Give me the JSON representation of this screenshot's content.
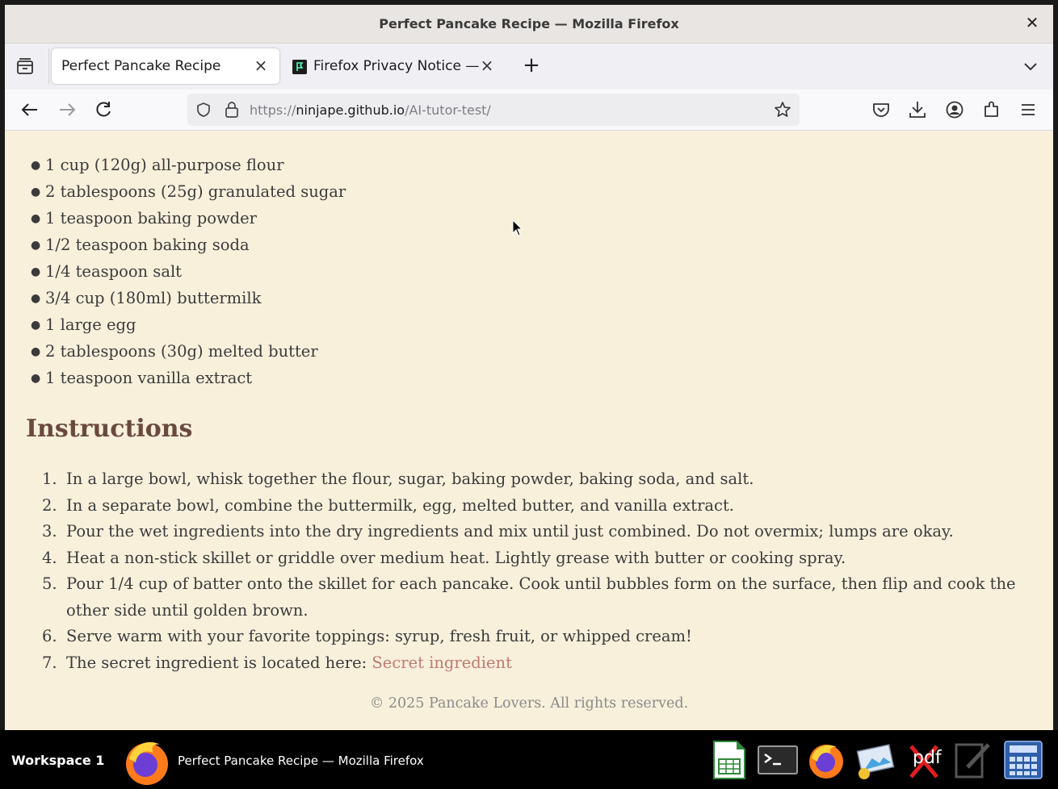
{
  "window": {
    "title": "Perfect Pancake Recipe — Mozilla Firefox"
  },
  "tabs": [
    {
      "label": "Perfect Pancake Recipe",
      "active": true
    },
    {
      "label": "Firefox Privacy Notice — ",
      "active": false
    }
  ],
  "urlbar": {
    "scheme": "https://",
    "host": "ninjape.github.io",
    "path": "/AI-tutor-test/"
  },
  "content": {
    "ingredients": [
      "1 cup (120g) all-purpose flour",
      "2 tablespoons (25g) granulated sugar",
      "1 teaspoon baking powder",
      "1/2 teaspoon baking soda",
      "1/4 teaspoon salt",
      "3/4 cup (180ml) buttermilk",
      "1 large egg",
      "2 tablespoons (30g) melted butter",
      "1 teaspoon vanilla extract"
    ],
    "instructions_title": "Instructions",
    "steps": [
      "In a large bowl, whisk together the flour, sugar, baking powder, baking soda, and salt.",
      "In a separate bowl, combine the buttermilk, egg, melted butter, and vanilla extract.",
      "Pour the wet ingredients into the dry ingredients and mix until just combined. Do not overmix; lumps are okay.",
      "Heat a non-stick skillet or griddle over medium heat. Lightly grease with butter or cooking spray.",
      "Pour 1/4 cup of batter onto the skillet for each pancake. Cook until bubbles form on the surface, then flip and cook the other side until golden brown.",
      "Serve warm with your favorite toppings: syrup, fresh fruit, or whipped cream!"
    ],
    "secret_step_text": "The secret ingredient is located here: ",
    "secret_link": "Secret ingredient",
    "footer": "© 2025 Pancake Lovers. All rights reserved."
  },
  "taskbar": {
    "workspace": "Workspace 1",
    "task_title": "Perfect Pancake Recipe — Mozilla Firefox",
    "pdf_label": "pdf"
  },
  "colors": {
    "page_bg": "#f9f0dc",
    "heading": "#6a4a3c",
    "link": "#c27a6e"
  }
}
